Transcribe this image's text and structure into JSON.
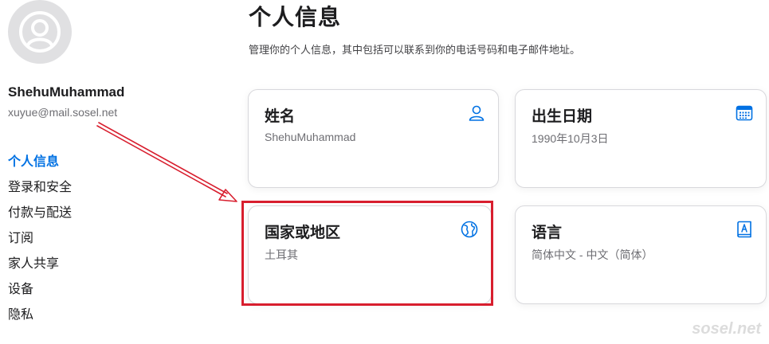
{
  "user": {
    "name": "ShehuMuhammad",
    "email": "xuyue@mail.sosel.net",
    "avatar_icon": "person-circle-icon"
  },
  "nav": {
    "items": [
      {
        "label": "个人信息",
        "active": true
      },
      {
        "label": "登录和安全",
        "active": false
      },
      {
        "label": "付款与配送",
        "active": false
      },
      {
        "label": "订阅",
        "active": false
      },
      {
        "label": "家人共享",
        "active": false
      },
      {
        "label": "设备",
        "active": false
      },
      {
        "label": "隐私",
        "active": false
      }
    ]
  },
  "page": {
    "title": "个人信息",
    "description": "管理你的个人信息，其中包括可以联系到你的电话号码和电子邮件地址。"
  },
  "cards": {
    "name": {
      "title": "姓名",
      "value": "ShehuMuhammad",
      "icon": "person-icon"
    },
    "birthday": {
      "title": "出生日期",
      "value": "1990年10月3日",
      "icon": "calendar-icon"
    },
    "region": {
      "title": "国家或地区",
      "value": "土耳其",
      "icon": "globe-icon"
    },
    "language": {
      "title": "语言",
      "value": "简体中文 - 中文（简体）",
      "icon": "book-icon"
    }
  },
  "annotation": {
    "highlight_color": "#d81e2e",
    "arrow_color": "#d81e2e",
    "highlight_target": "region-card"
  },
  "colors": {
    "accent": "#0071e3",
    "text": "#1d1d1f",
    "secondary_text": "#6e6e73"
  },
  "watermark": "sosel.net"
}
